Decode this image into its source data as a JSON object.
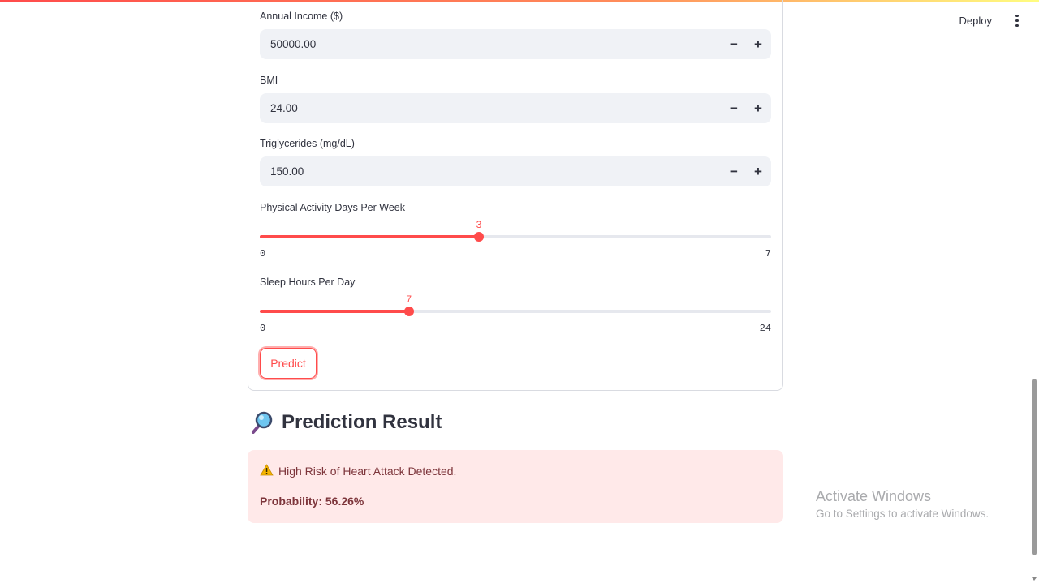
{
  "header": {
    "deploy_label": "Deploy",
    "menu_icon": "kebab-menu-icon"
  },
  "form": {
    "fields": [
      {
        "label": "Annual Income ($)",
        "value": "50000.00"
      },
      {
        "label": "BMI",
        "value": "24.00"
      },
      {
        "label": "Triglycerides (mg/dL)",
        "value": "150.00"
      }
    ],
    "step_minus": "−",
    "step_plus": "+",
    "sliders": [
      {
        "label": "Physical Activity Days Per Week",
        "value": 3,
        "min": 0,
        "max": 7,
        "value_text": "3",
        "min_text": "0",
        "max_text": "7"
      },
      {
        "label": "Sleep Hours Per Day",
        "value": 7,
        "min": 0,
        "max": 24,
        "value_text": "7",
        "min_text": "0",
        "max_text": "24"
      }
    ],
    "predict_label": "Predict"
  },
  "result": {
    "icon": "magnifying-glass-icon",
    "title": "Prediction Result",
    "alert_icon": "warning-icon",
    "alert_text": "High Risk of Heart Attack Detected.",
    "probability_text": "Probability: 56.26%"
  },
  "watermark": {
    "title": "Activate Windows",
    "subtitle": "Go to Settings to activate Windows."
  },
  "colors": {
    "accent": "#ff4b4b",
    "alert_bg": "#ffe9e9",
    "alert_text": "#7d353b",
    "input_bg": "#f0f2f6"
  }
}
